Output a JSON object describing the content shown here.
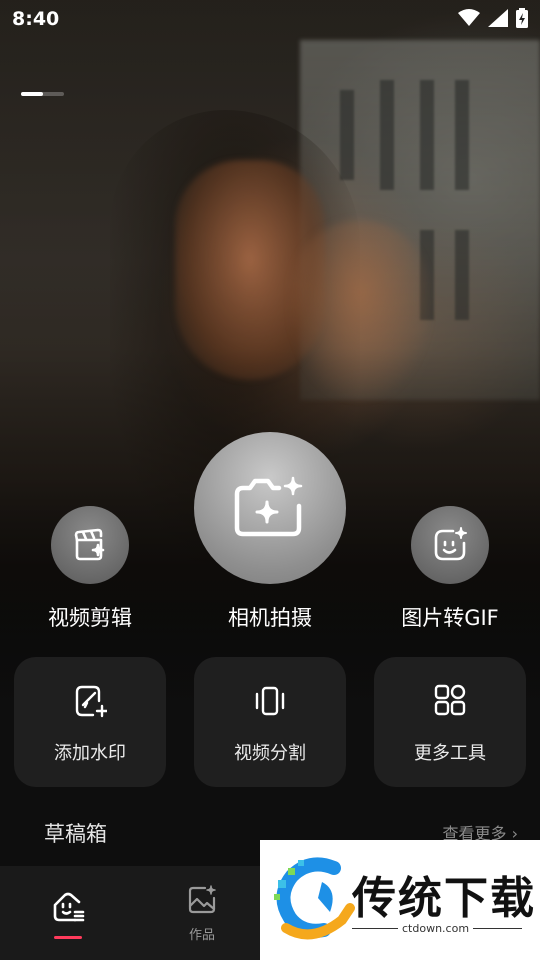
{
  "status_bar": {
    "time": "8:40",
    "icons": [
      "wifi-icon",
      "signal-icon",
      "battery-charging-icon"
    ]
  },
  "banner": {
    "progress": 0.5
  },
  "actions": {
    "video_edit": {
      "label": "视频剪辑",
      "icon": "clapperboard-sparkle-icon"
    },
    "camera": {
      "label": "相机拍摄",
      "icon": "camera-sparkle-icon"
    },
    "image_to_gif": {
      "label": "图片转GIF",
      "icon": "face-sparkle-icon"
    }
  },
  "tools": [
    {
      "label": "添加水印",
      "icon": "watermark-add-icon"
    },
    {
      "label": "视频分割",
      "icon": "video-split-icon"
    },
    {
      "label": "更多工具",
      "icon": "more-tools-icon"
    }
  ],
  "drafts": {
    "title": "草稿箱",
    "more_label": "查看更多"
  },
  "bottom_nav": [
    {
      "label": "",
      "icon": "home-face-icon",
      "active": true
    },
    {
      "label": "作品",
      "icon": "works-image-icon",
      "active": false
    }
  ],
  "watermark": {
    "title": "传统下载",
    "url": "ctdown.com"
  },
  "colors": {
    "accent": "#ff3b5c",
    "card_bg": "#1f1f1f",
    "nav_bg": "#1a1a1a"
  }
}
